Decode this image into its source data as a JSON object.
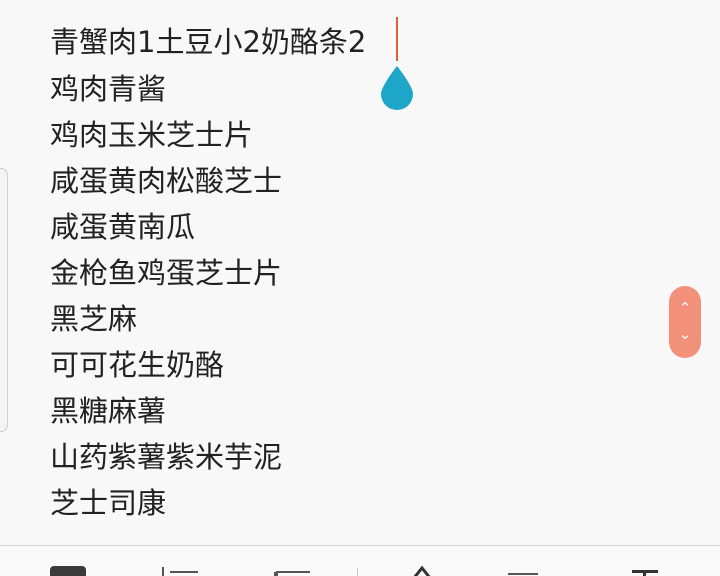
{
  "editor": {
    "lines": [
      "青蟹肉1土豆小2奶酪条2",
      "鸡肉青酱",
      "鸡肉玉米芝士片",
      "咸蛋黄肉松酸芝士",
      "咸蛋黄南瓜",
      "金枪鱼鸡蛋芝士片",
      "黑芝麻",
      "可可花生奶酪",
      "黑糖麻薯",
      "山药紫薯紫米芋泥",
      "芝士司康"
    ]
  },
  "colors": {
    "cursor": "#e0603a",
    "cursor_handle": "#1da6c8",
    "scroll_pill": "#f2907a",
    "text": "#222222"
  },
  "icons": {
    "cursor_handle": "water-drop-icon",
    "scroll_up": "chevron-up-icon",
    "scroll_down": "chevron-down-icon",
    "toolbar": [
      "checkbox-icon",
      "numbered-list-icon",
      "bullet-list-icon",
      "text-size-icon",
      "align-icon",
      "text-format-icon"
    ]
  },
  "scroll": {
    "up_glyph": "⌃",
    "down_glyph": "⌄"
  }
}
